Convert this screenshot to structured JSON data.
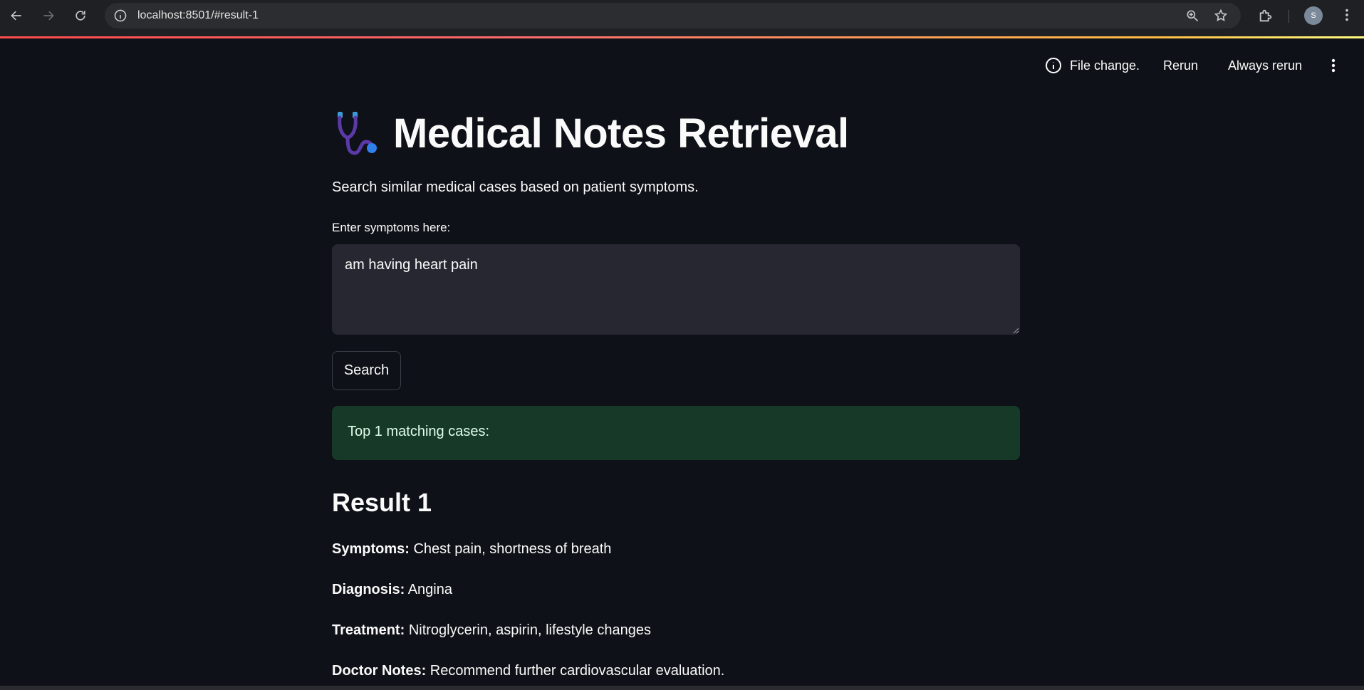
{
  "browser": {
    "url": "localhost:8501/#result-1",
    "avatar_initial": "S"
  },
  "app_header": {
    "status_text": "File change.",
    "rerun_label": "Rerun",
    "always_rerun_label": "Always rerun"
  },
  "page": {
    "title": "Medical Notes Retrieval",
    "subtitle": "Search similar medical cases based on patient symptoms."
  },
  "form": {
    "label": "Enter symptoms here:",
    "value": "am having heart pain",
    "search_label": "Search"
  },
  "results": {
    "summary": "Top 1 matching cases:",
    "items": [
      {
        "heading": "Result 1",
        "symptoms_label": "Symptoms:",
        "symptoms": "Chest pain, shortness of breath",
        "diagnosis_label": "Diagnosis:",
        "diagnosis": "Angina",
        "treatment_label": "Treatment:",
        "treatment": "Nitroglycerin, aspirin, lifestyle changes",
        "notes_label": "Doctor Notes:",
        "notes": "Recommend further cardiovascular evaluation."
      }
    ]
  },
  "colors": {
    "background": "#0e1117",
    "input_bg": "#262730",
    "success_bg": "#173928",
    "success_text": "#dffde9",
    "accent_gradient": [
      "#ff4b4b",
      "#ffbd45",
      "#fffd80"
    ]
  }
}
